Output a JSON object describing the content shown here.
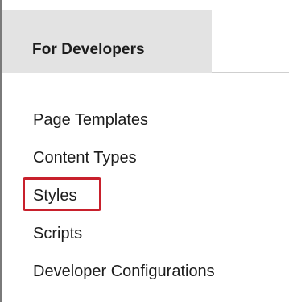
{
  "panel": {
    "title": "For Developers",
    "items": [
      {
        "label": "Page Templates"
      },
      {
        "label": "Content Types"
      },
      {
        "label": "Styles",
        "highlighted": true
      },
      {
        "label": "Scripts"
      },
      {
        "label": "Developer Configurations"
      }
    ]
  },
  "colors": {
    "header_bg": "#e3e3e3",
    "text": "#1c1c1c",
    "highlight_border": "#c8202c"
  }
}
